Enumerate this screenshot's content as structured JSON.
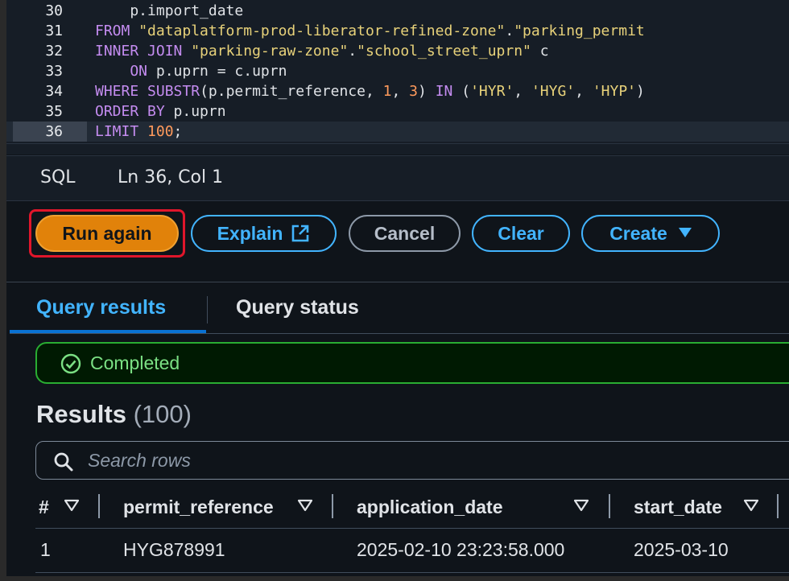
{
  "editor": {
    "lines": [
      {
        "num": "30",
        "parts": [
          [
            "",
            "    p.import_date"
          ]
        ]
      },
      {
        "num": "31",
        "parts": [
          [
            "kw",
            "FROM "
          ],
          [
            "str",
            "\"dataplatform-prod-liberator-refined-zone\""
          ],
          [
            "punc",
            "."
          ],
          [
            "str",
            "\"parking_permit"
          ]
        ]
      },
      {
        "num": "32",
        "parts": [
          [
            "kw",
            "INNER JOIN "
          ],
          [
            "str",
            "\"parking-raw-zone\""
          ],
          [
            "punc",
            "."
          ],
          [
            "str",
            "\"school_street_uprn\""
          ],
          [
            "punc",
            " c"
          ]
        ]
      },
      {
        "num": "33",
        "parts": [
          [
            "kw",
            "    ON "
          ],
          [
            "punc",
            "p.uprn = c.uprn"
          ]
        ]
      },
      {
        "num": "34",
        "parts": [
          [
            "kw",
            "WHERE "
          ],
          [
            "kw",
            "SUBSTR"
          ],
          [
            "punc",
            "(p.permit_reference, "
          ],
          [
            "num",
            "1"
          ],
          [
            "punc",
            ", "
          ],
          [
            "num",
            "3"
          ],
          [
            "punc",
            ") "
          ],
          [
            "kw",
            "IN "
          ],
          [
            "punc",
            "("
          ],
          [
            "str",
            "'HYR'"
          ],
          [
            "punc",
            ", "
          ],
          [
            "str",
            "'HYG'"
          ],
          [
            "punc",
            ", "
          ],
          [
            "str",
            "'HYP'"
          ],
          [
            "punc",
            ")"
          ]
        ]
      },
      {
        "num": "35",
        "parts": [
          [
            "kw",
            "ORDER BY "
          ],
          [
            "punc",
            "p.uprn"
          ]
        ]
      },
      {
        "num": "36",
        "parts": [
          [
            "kw",
            "LIMIT "
          ],
          [
            "num",
            "100"
          ],
          [
            "punc",
            ";"
          ]
        ]
      }
    ]
  },
  "statusbar": {
    "language": "SQL",
    "position": "Ln 36, Col 1"
  },
  "actions": {
    "run_again": "Run again",
    "explain": "Explain",
    "cancel": "Cancel",
    "clear": "Clear",
    "create": "Create"
  },
  "tabs": {
    "results": "Query results",
    "status": "Query status"
  },
  "alert": {
    "status": "Completed"
  },
  "results": {
    "title": "Results",
    "count": "(100)",
    "search_placeholder": "Search rows",
    "columns": [
      "#",
      "permit_reference",
      "application_date",
      "start_date"
    ],
    "rows": [
      [
        "1",
        "HYG878991",
        "2025-02-10 23:23:58.000",
        "2025-03-10"
      ]
    ]
  },
  "colors": {
    "accent": "#42b4ff",
    "primary_button": "#e1820a",
    "success": "#29ad32",
    "highlight_outline": "#e0162b"
  }
}
